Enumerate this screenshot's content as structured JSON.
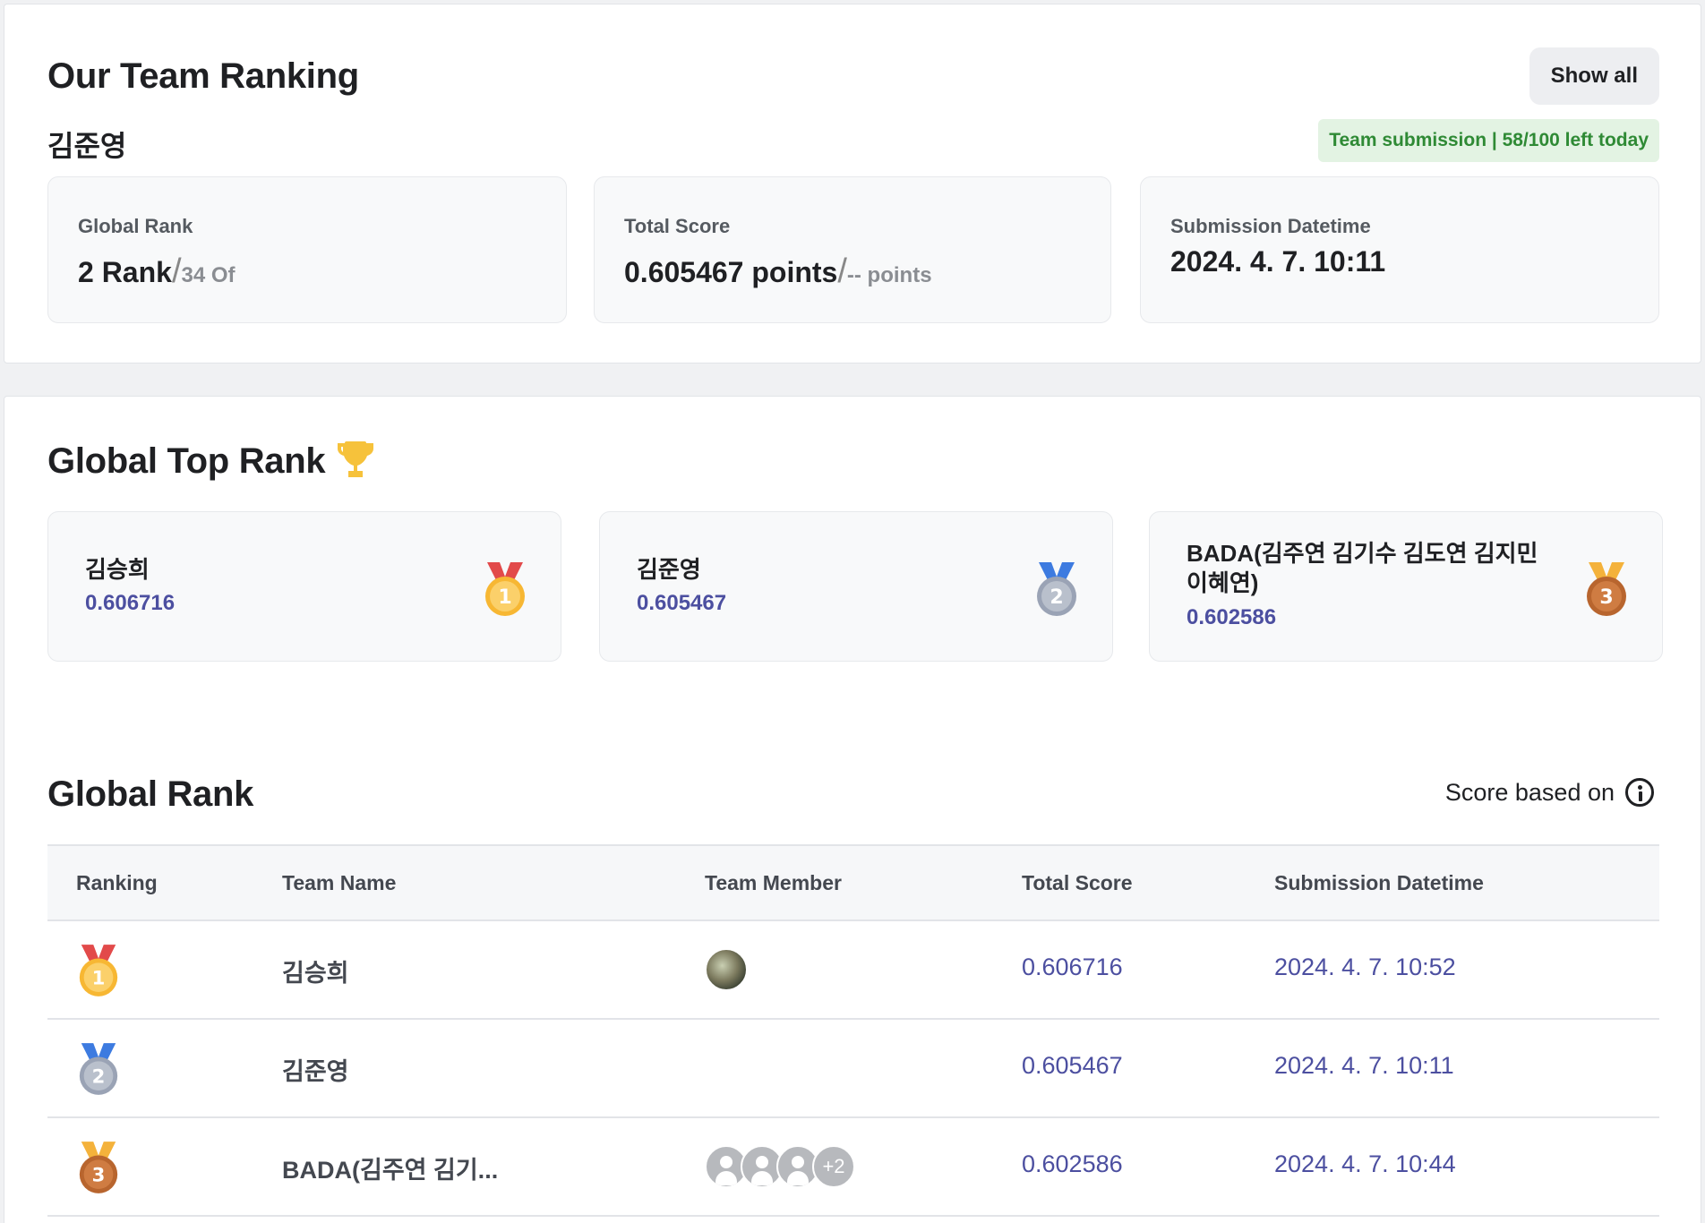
{
  "team_ranking": {
    "title": "Our Team Ranking",
    "team_name": "김준영",
    "show_all_label": "Show all",
    "submission_badge": "Team submission | 58/100 left today",
    "cards": {
      "global_rank": {
        "label": "Global Rank",
        "value": "2 Rank",
        "sep": "/",
        "total": "34 Of"
      },
      "total_score": {
        "label": "Total Score",
        "value": "0.605467 points",
        "sep": "/",
        "max": "-- points"
      },
      "submission": {
        "label": "Submission Datetime",
        "value": "2024. 4. 7. 10:11"
      }
    }
  },
  "global_top": {
    "title": "Global Top Rank",
    "icon": "trophy-icon",
    "cards": [
      {
        "name": "김승희",
        "score": "0.606716",
        "medal": "gold-medal-icon",
        "rank": "1"
      },
      {
        "name": "김준영",
        "score": "0.605467",
        "medal": "silver-medal-icon",
        "rank": "2"
      },
      {
        "name": "BADA(김주연 김기수 김도연 김지민 이혜연)",
        "score": "0.602586",
        "medal": "bronze-medal-icon",
        "rank": "3"
      }
    ]
  },
  "global_rank": {
    "title": "Global Rank",
    "score_based_label": "Score based on",
    "columns": [
      "Ranking",
      "Team Name",
      "Team Member",
      "Total Score",
      "Submission Datetime"
    ],
    "rows": [
      {
        "rank": "1",
        "team": "김승희",
        "score": "0.606716",
        "date": "2024. 4. 7. 10:52",
        "members": "photo"
      },
      {
        "rank": "2",
        "team": "김준영",
        "score": "0.605467",
        "date": "2024. 4. 7. 10:11",
        "members": "none"
      },
      {
        "rank": "3",
        "team": "BADA(김주연 김기...",
        "score": "0.602586",
        "date": "2024. 4. 7. 10:44",
        "members": "3 avatars",
        "more": "+2"
      }
    ]
  },
  "colors": {
    "accent": "#4c4fa0",
    "badge_bg": "#e3f3e3",
    "badge_text": "#2f8a35",
    "gold": "#f7b733",
    "silver": "#9aa3b5",
    "bronze": "#b8652e"
  }
}
